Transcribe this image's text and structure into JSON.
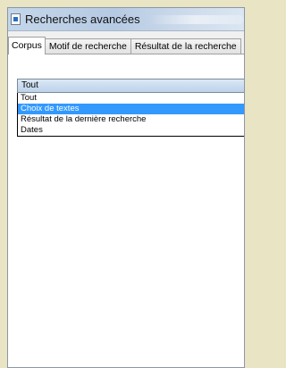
{
  "window": {
    "title": "Recherches avancées"
  },
  "tabs": [
    {
      "label": "Corpus",
      "active": true
    },
    {
      "label": "Motif de recherche",
      "active": false
    },
    {
      "label": "Résultat de la recherche",
      "active": false
    }
  ],
  "corpus": {
    "selected_value": "Tout",
    "options": [
      {
        "label": "Tout",
        "selected": false
      },
      {
        "label": "Choix de textes",
        "selected": true
      },
      {
        "label": "Résultat de la dernière recherche",
        "selected": false
      },
      {
        "label": "Dates",
        "selected": false
      }
    ]
  },
  "colors": {
    "selection": "#3399ff",
    "combo_gradient_top": "#dbe8f6",
    "combo_gradient_bottom": "#bcd2ea",
    "backdrop": "#e8e4c4"
  }
}
